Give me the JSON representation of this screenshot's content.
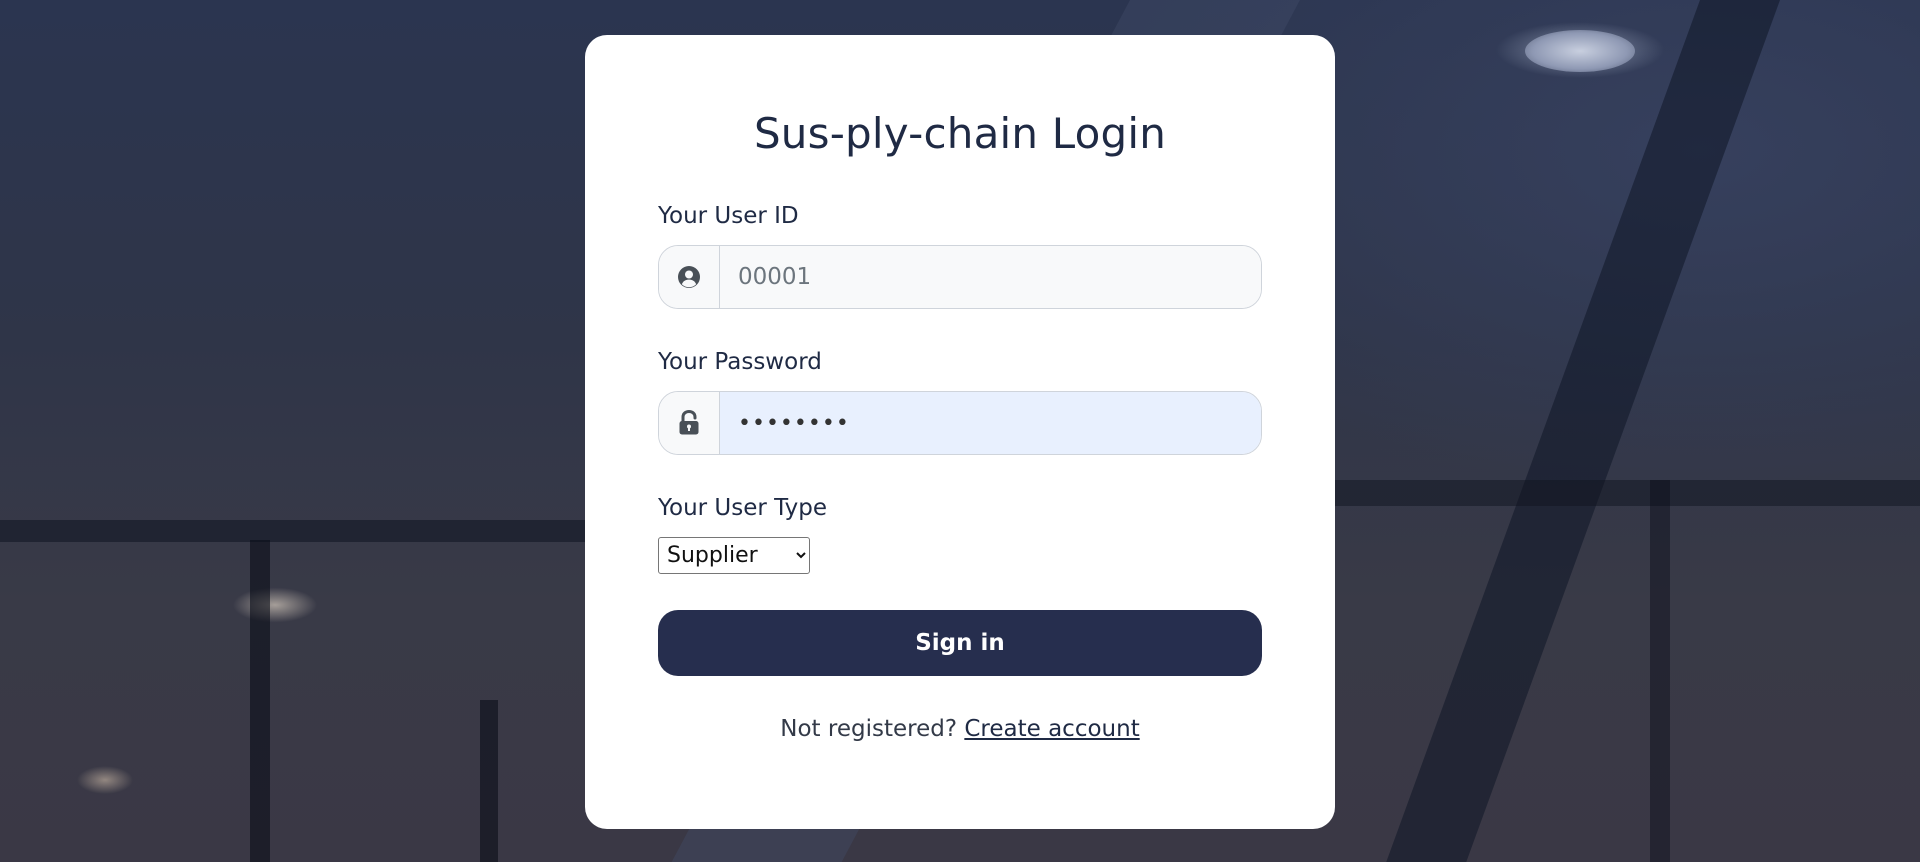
{
  "page": {
    "title": "Sus-ply-chain Login"
  },
  "form": {
    "user_id": {
      "label": "Your User ID",
      "placeholder": "00001",
      "icon": "user-circle-icon"
    },
    "password": {
      "label": "Your Password",
      "value": "••••••••",
      "icon": "unlock-icon"
    },
    "user_type": {
      "label": "Your User Type",
      "selected": "Supplier"
    },
    "submit_label": "Sign in"
  },
  "footer": {
    "prompt": "Not registered?",
    "link_label": "Create account"
  },
  "colors": {
    "primary_button": "#262e4e",
    "title_text": "#1f2a44",
    "password_fill": "#e8f0fe",
    "userid_fill": "#f8f9fa"
  }
}
